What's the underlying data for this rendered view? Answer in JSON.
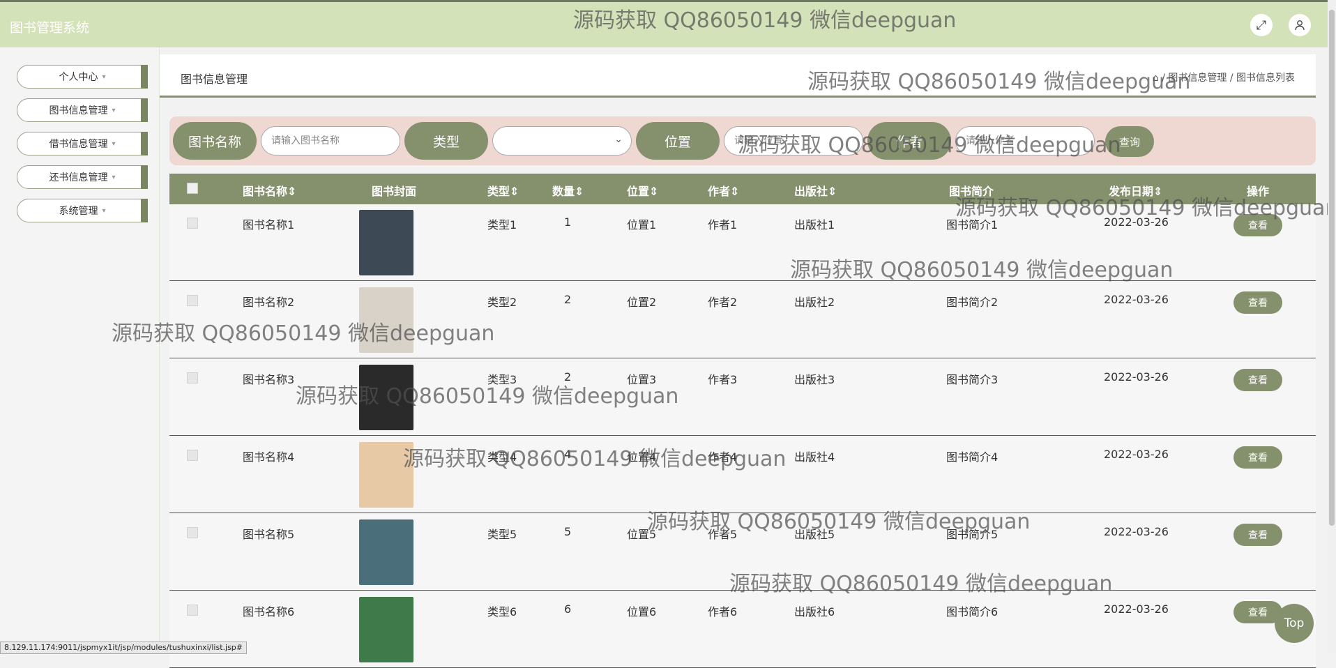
{
  "header": {
    "app_title": "图书管理系统",
    "fullscreen_icon": "fullscreen-icon",
    "user_icon": "user-icon"
  },
  "sidebar": {
    "items": [
      {
        "label": "个人中心"
      },
      {
        "label": "图书信息管理"
      },
      {
        "label": "借书信息管理"
      },
      {
        "label": "还书信息管理"
      },
      {
        "label": "系统管理"
      }
    ]
  },
  "breadcrumb": {
    "title": "图书信息管理",
    "path": "⌂ / 图书信息管理 / 图书信息列表"
  },
  "search": {
    "name_label": "图书名称",
    "name_placeholder": "请输入图书名称",
    "type_label": "类型",
    "type_value": "",
    "location_label": "位置",
    "location_placeholder": "请输入位置",
    "author_label": "作者",
    "author_placeholder": "请输入作者",
    "search_button": "查询"
  },
  "table": {
    "columns": [
      "图书名称",
      "图书封面",
      "类型",
      "数量",
      "位置",
      "作者",
      "出版社",
      "图书简介",
      "发布日期",
      "操作"
    ],
    "sort_glyph": "⇕",
    "rows": [
      {
        "name": "图书名称1",
        "type": "类型1",
        "qty": "1",
        "location": "位置1",
        "author": "作者1",
        "publisher": "出版社1",
        "intro": "图书简介1",
        "date": "2022-03-26",
        "action": "查看",
        "cover_color": "#3d4a56"
      },
      {
        "name": "图书名称2",
        "type": "类型2",
        "qty": "2",
        "location": "位置2",
        "author": "作者2",
        "publisher": "出版社2",
        "intro": "图书简介2",
        "date": "2022-03-26",
        "action": "查看",
        "cover_color": "#d9d2c8"
      },
      {
        "name": "图书名称3",
        "type": "类型3",
        "qty": "2",
        "location": "位置3",
        "author": "作者3",
        "publisher": "出版社3",
        "intro": "图书简介3",
        "date": "2022-03-26",
        "action": "查看",
        "cover_color": "#2a2a2a"
      },
      {
        "name": "图书名称4",
        "type": "类型4",
        "qty": "4",
        "location": "位置4",
        "author": "作者4",
        "publisher": "出版社4",
        "intro": "图书简介4",
        "date": "2022-03-26",
        "action": "查看",
        "cover_color": "#e8c9a6"
      },
      {
        "name": "图书名称5",
        "type": "类型5",
        "qty": "5",
        "location": "位置5",
        "author": "作者5",
        "publisher": "出版社5",
        "intro": "图书简介5",
        "date": "2022-03-26",
        "action": "查看",
        "cover_color": "#4b6f7a"
      },
      {
        "name": "图书名称6",
        "type": "类型6",
        "qty": "6",
        "location": "位置6",
        "author": "作者6",
        "publisher": "出版社6",
        "intro": "图书简介6",
        "date": "2022-03-26",
        "action": "查看",
        "cover_color": "#3f7a4a"
      }
    ]
  },
  "watermark_text": "源码获取 QQ86050149 微信deepguan",
  "back_to_top": "Top",
  "status_url": "8.129.11.174:9011/jspmyx1it/jsp/modules/tushuxinxi/list.jsp#"
}
